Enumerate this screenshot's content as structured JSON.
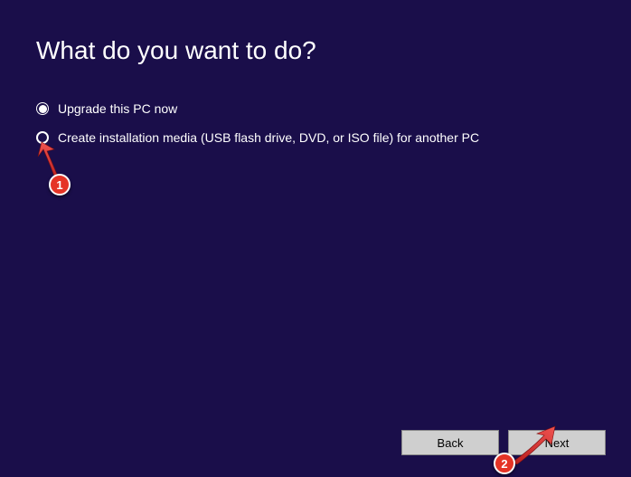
{
  "heading": "What do you want to do?",
  "options": [
    {
      "label": "Upgrade this PC now",
      "selected": true
    },
    {
      "label": "Create installation media (USB flash drive, DVD, or ISO file) for another PC",
      "selected": false
    }
  ],
  "buttons": {
    "back": "Back",
    "next": "Next"
  },
  "annotations": {
    "badge1": "1",
    "badge2": "2"
  }
}
